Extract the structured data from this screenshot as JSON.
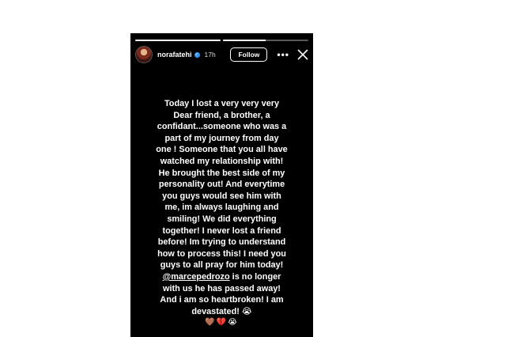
{
  "story": {
    "progress": [
      1,
      0.5
    ],
    "user": {
      "username": "norafatehi",
      "verified_icon": "verified-badge-icon",
      "time_ago": "17h"
    },
    "follow_label": "Follow",
    "more_label": "•••",
    "close_icon": "close-icon",
    "caption": {
      "lines": [
        "Today I lost a very very very",
        "Dear friend, a brother, a",
        "confidant...someone who was a",
        "part of my journey from day",
        "one ! Someone that you all have",
        "watched my relationship with!",
        "He brought the best side of my",
        "personality out! And everytime",
        "you guys would see him with",
        "me, im always laughing and",
        "smiling! We did everything",
        "together! I never lost a friend",
        "before! Im trying to understand",
        "how to process this! I need you",
        "guys to all pray for him today!"
      ],
      "mention": "@marcepedrozo",
      "mention_rest": " is no longer",
      "lines_after": [
        "with us he has passed away!",
        "And i am so heartbroken! I am",
        "devastated! 😭"
      ],
      "emoji_line": "🤎💔😭"
    }
  }
}
